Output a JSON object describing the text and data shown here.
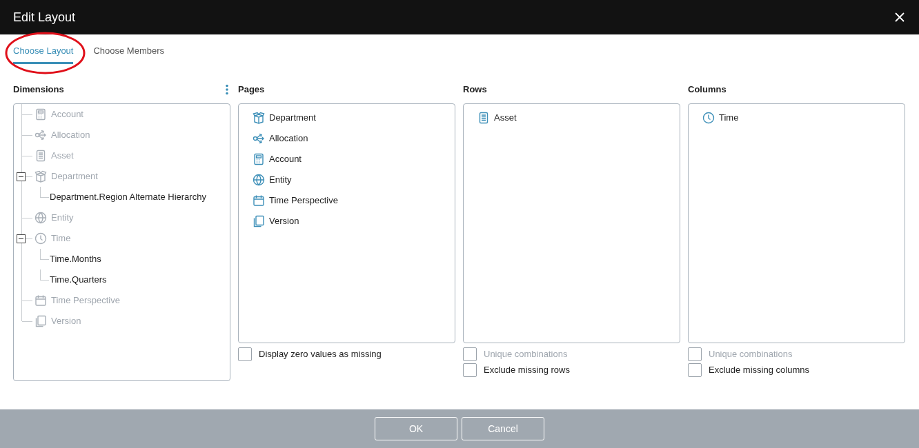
{
  "dialog": {
    "title": "Edit Layout"
  },
  "tabs": [
    {
      "label": "Choose Layout",
      "selected": true
    },
    {
      "label": "Choose Members",
      "selected": false
    }
  ],
  "dimensions": {
    "title": "Dimensions",
    "items": [
      {
        "label": "Account",
        "kind": "calculator",
        "disabled": true
      },
      {
        "label": "Allocation",
        "kind": "share",
        "disabled": true
      },
      {
        "label": "Asset",
        "kind": "list",
        "disabled": true
      },
      {
        "label": "Department",
        "kind": "box",
        "disabled": true,
        "expanded": true,
        "children": [
          {
            "label": "Department.Region Alternate Hierarchy"
          }
        ]
      },
      {
        "label": "Entity",
        "kind": "globe",
        "disabled": true
      },
      {
        "label": "Time",
        "kind": "clock",
        "disabled": true,
        "expanded": true,
        "children": [
          {
            "label": "Time.Months"
          },
          {
            "label": "Time.Quarters"
          }
        ]
      },
      {
        "label": "Time Perspective",
        "kind": "calendar",
        "disabled": true
      },
      {
        "label": "Version",
        "kind": "copy",
        "disabled": true
      }
    ]
  },
  "panels": [
    {
      "title": "Pages",
      "items": [
        {
          "label": "Department",
          "kind": "box"
        },
        {
          "label": "Allocation",
          "kind": "share"
        },
        {
          "label": "Account",
          "kind": "calculator"
        },
        {
          "label": "Entity",
          "kind": "globe"
        },
        {
          "label": "Time Perspective",
          "kind": "calendar"
        },
        {
          "label": "Version",
          "kind": "copy"
        }
      ],
      "options": [
        {
          "label": "Display zero values as missing",
          "checked": false,
          "disabled": false
        }
      ]
    },
    {
      "title": "Rows",
      "items": [
        {
          "label": "Asset",
          "kind": "list"
        }
      ],
      "options": [
        {
          "label": "Unique combinations",
          "checked": false,
          "disabled": true
        },
        {
          "label": "Exclude missing rows",
          "checked": false,
          "disabled": false
        }
      ]
    },
    {
      "title": "Columns",
      "items": [
        {
          "label": "Time",
          "kind": "clock"
        }
      ],
      "options": [
        {
          "label": "Unique combinations",
          "checked": false,
          "disabled": true
        },
        {
          "label": "Exclude missing columns",
          "checked": false,
          "disabled": false
        }
      ]
    }
  ],
  "buttons": [
    {
      "label": "OK"
    },
    {
      "label": "Cancel"
    }
  ]
}
